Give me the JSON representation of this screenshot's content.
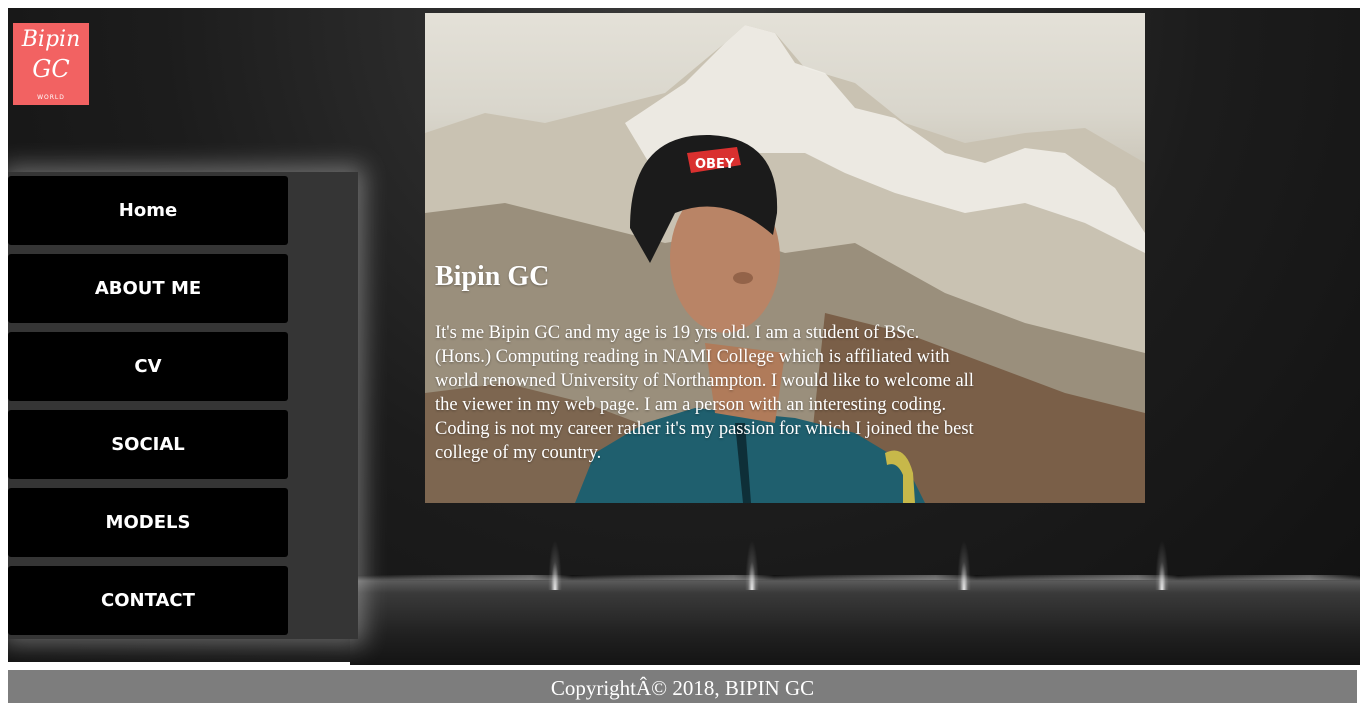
{
  "logo": {
    "line1": "Bipin",
    "line2": "GC",
    "line3": "WORLD"
  },
  "nav": {
    "items": [
      {
        "label": "Home"
      },
      {
        "label": "ABOUT ME"
      },
      {
        "label": "CV"
      },
      {
        "label": "SOCIAL"
      },
      {
        "label": "MODELS"
      },
      {
        "label": "CONTACT"
      }
    ]
  },
  "hero": {
    "title": "Bipin GC",
    "text": "It's me Bipin GC and my age is 19 yrs old. I am a student of BSc. (Hons.) Computing reading in NAMI College which is affiliated with world renowned University of Northampton. I would like to welcome all the viewer in my web page. I am a person with an interesting coding. Coding is not my career rather it's my passion for which I joined the best college of my country.",
    "cap_text": "OBEY"
  },
  "footer": {
    "text": "CopyrightÂ© 2018, BIPIN GC"
  },
  "colors": {
    "logo_bg": "#f26262",
    "sidebar_bg": "#353535",
    "nav_bg": "#000000",
    "footer_bg": "#7d7d7d"
  }
}
